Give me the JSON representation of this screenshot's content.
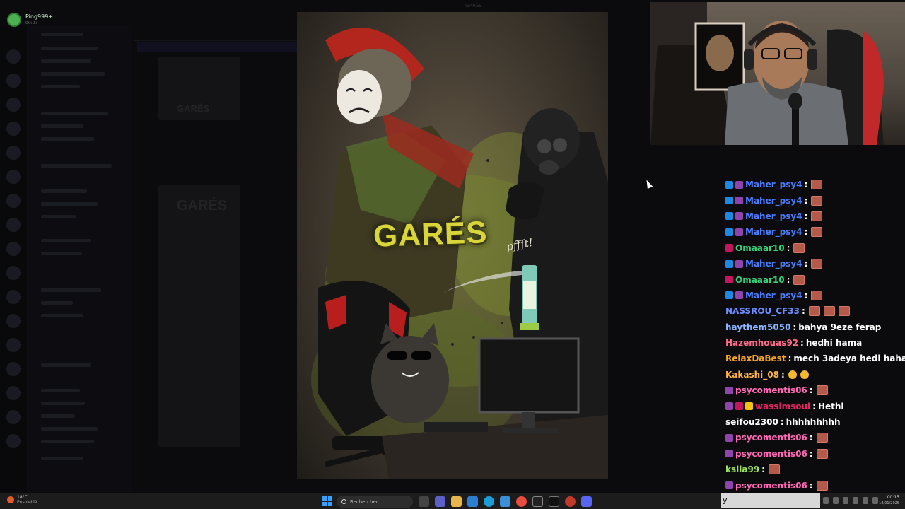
{
  "discord": {
    "username": "Ping999+",
    "user_status": "00:07",
    "bg_post_title": "GARÉS",
    "window_title": "GARÉS"
  },
  "poster": {
    "title": "GARÉS",
    "sound_effect": "pffft!"
  },
  "chat": {
    "messages": [
      {
        "badges": [
          "blue",
          "purple"
        ],
        "user": "Maher_psy4",
        "color": "#4a7cff",
        "text": "",
        "emotes": 1,
        "emoji": 0
      },
      {
        "badges": [
          "blue",
          "purple"
        ],
        "user": "Maher_psy4",
        "color": "#4a7cff",
        "text": "",
        "emotes": 1,
        "emoji": 0
      },
      {
        "badges": [
          "blue",
          "purple"
        ],
        "user": "Maher_psy4",
        "color": "#4a7cff",
        "text": "",
        "emotes": 1,
        "emoji": 0
      },
      {
        "badges": [
          "blue",
          "purple"
        ],
        "user": "Maher_psy4",
        "color": "#4a7cff",
        "text": "",
        "emotes": 1,
        "emoji": 0
      },
      {
        "badges": [
          "pink"
        ],
        "user": "Omaaar10",
        "color": "#33d17a",
        "text": "",
        "emotes": 1,
        "emoji": 0
      },
      {
        "badges": [
          "blue",
          "purple"
        ],
        "user": "Maher_psy4",
        "color": "#4a7cff",
        "text": "",
        "emotes": 1,
        "emoji": 0
      },
      {
        "badges": [
          "pink"
        ],
        "user": "Omaaar10",
        "color": "#33d17a",
        "text": "",
        "emotes": 1,
        "emoji": 0
      },
      {
        "badges": [
          "blue",
          "purple"
        ],
        "user": "Maher_psy4",
        "color": "#4a7cff",
        "text": "",
        "emotes": 1,
        "emoji": 0
      },
      {
        "badges": [],
        "user": "NASSROU_CF33",
        "color": "#6d8bff",
        "text": "",
        "emotes": 3,
        "emoji": 0
      },
      {
        "badges": [],
        "user": "haythem5050",
        "color": "#8ab4ff",
        "text": "bahya 9eze ferap",
        "emotes": 0,
        "emoji": 0
      },
      {
        "badges": [],
        "user": "Hazemhouas92",
        "color": "#ff6b8a",
        "text": "hedhi hama",
        "emotes": 0,
        "emoji": 0
      },
      {
        "badges": [],
        "user": "RelaxDaBest",
        "color": "#f5a623",
        "text": "mech 3adeya hedi haha",
        "emotes": 0,
        "emoji": 0
      },
      {
        "badges": [],
        "user": "Kakashi_08",
        "color": "#ffb347",
        "text": "",
        "emotes": 0,
        "emoji": 2
      },
      {
        "badges": [
          "purple"
        ],
        "user": "psycomentis06",
        "color": "#ff69b4",
        "text": "",
        "emotes": 1,
        "emoji": 0
      },
      {
        "badges": [
          "purple",
          "pink",
          "gold"
        ],
        "user": "wassimsoui",
        "color": "#e0245e",
        "text": "Hethi",
        "emotes": 0,
        "emoji": 0
      },
      {
        "badges": [],
        "user": "seifou2300",
        "color": "#ffffff",
        "text": "hhhhhhhhh",
        "emotes": 0,
        "emoji": 0
      },
      {
        "badges": [
          "purple"
        ],
        "user": "psycomentis06",
        "color": "#ff69b4",
        "text": "",
        "emotes": 1,
        "emoji": 0
      },
      {
        "badges": [
          "purple"
        ],
        "user": "psycomentis06",
        "color": "#ff69b4",
        "text": "",
        "emotes": 1,
        "emoji": 0
      },
      {
        "badges": [],
        "user": "ksila99",
        "color": "#9be15d",
        "text": "",
        "emotes": 1,
        "emoji": 0
      },
      {
        "badges": [
          "purple"
        ],
        "user": "psycomentis06",
        "color": "#ff69b4",
        "text": "",
        "emotes": 1,
        "emoji": 0
      }
    ],
    "input_value": "y"
  },
  "taskbar": {
    "weather_temp": "18°C",
    "weather_desc": "Ensoleillé",
    "search_placeholder": "Rechercher",
    "time": "00:15",
    "date": "18/01/2026"
  }
}
